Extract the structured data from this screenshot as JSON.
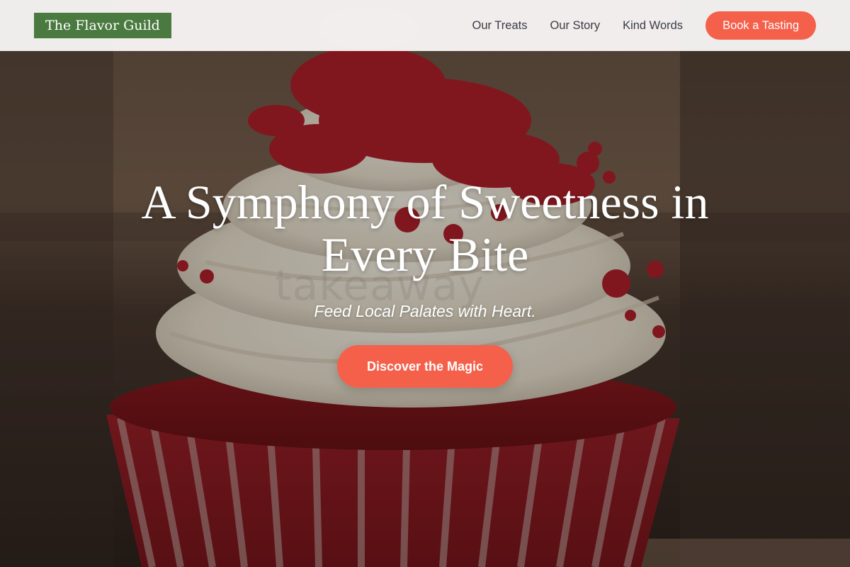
{
  "brand": {
    "name": "The Flavor Guild",
    "color": "#4a7a3f"
  },
  "nav": {
    "links": [
      {
        "label": "Our Treats"
      },
      {
        "label": "Our Story"
      },
      {
        "label": "Kind Words"
      }
    ],
    "cta_label": "Book a Tasting"
  },
  "hero": {
    "title": "A Symphony of Sweetness in Every Bite",
    "subtitle": "Feed Local Palates with Heart.",
    "cta_label": "Discover the Magic",
    "watermark": "takeaway",
    "image_subject": "red-velvet-cupcake"
  },
  "colors": {
    "accent": "#f5604b",
    "brand_green": "#4a7a3f",
    "header_bg": "#f7f5f4",
    "nav_text": "#3a3c45"
  }
}
